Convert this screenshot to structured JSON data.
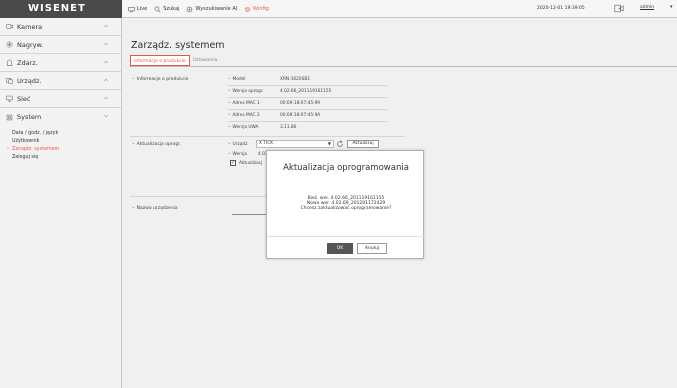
{
  "brand": "WISENET",
  "topnav": [
    {
      "label": "Live",
      "icon": "monitor-icon",
      "active": false
    },
    {
      "label": "Szukaj",
      "icon": "search-icon",
      "active": false
    },
    {
      "label": "Wyszukiwanie AI",
      "icon": "ai-search-icon",
      "active": false
    },
    {
      "label": "Konfig",
      "icon": "gear-icon",
      "active": true
    }
  ],
  "datetime": "2020-12-01 19:39:05",
  "user": "admin",
  "sidebar": {
    "items": [
      {
        "label": "Kamera",
        "icon": "camera-icon"
      },
      {
        "label": "Nagryw.",
        "icon": "record-icon"
      },
      {
        "label": "Zdarz.",
        "icon": "event-icon"
      },
      {
        "label": "Urządz.",
        "icon": "device-icon"
      },
      {
        "label": "Sieć",
        "icon": "network-icon"
      },
      {
        "label": "System",
        "icon": "system-icon"
      }
    ],
    "submenu": [
      "Data / godz. / język",
      "Użytkownik",
      "Zarządz. systemem",
      "Zaloguj się"
    ],
    "active_sub": "Zarządz. systemem"
  },
  "main": {
    "title": "Zarządz. systemem",
    "tabs": [
      "Informacje o produkcie",
      "Ustawienia"
    ],
    "product_info": {
      "section": "Informacje o produkcie",
      "fields": [
        {
          "label": "Model",
          "value": "XRN-1620SB1"
        },
        {
          "label": "Wersja oprogr.",
          "value": "4.02.66_201119161155"
        },
        {
          "label": "Adres MAC 1",
          "value": "00:09:18:67:45:99"
        },
        {
          "label": "Adres MAC 2",
          "value": "00:09:18:67:45:9A"
        },
        {
          "label": "Wersja UWA",
          "value": "3.11.86"
        }
      ]
    },
    "update": {
      "section": "Aktualizacja oprogr.",
      "device_label": "Urządz.",
      "device_value": "X TICK",
      "update_button": "Aktualizuj",
      "version_label": "Wersja",
      "version_value": "4.02",
      "auto_label": "Aktualizacj"
    },
    "device_name": {
      "section": "Nazwa urządzenia"
    }
  },
  "dialog": {
    "title": "Aktualizacja oprogramowania",
    "line1": "Bież. wer. 4.02.66_201119161155",
    "line2": "Nowa wer. 4.02.69_201201172429",
    "line3": "Chcesz zaktualizować oprogramowanie?",
    "ok": "OK",
    "cancel": "Anuluj"
  },
  "colors": {
    "accent": "#e8554e",
    "logo_bg": "#4a4a4a"
  }
}
